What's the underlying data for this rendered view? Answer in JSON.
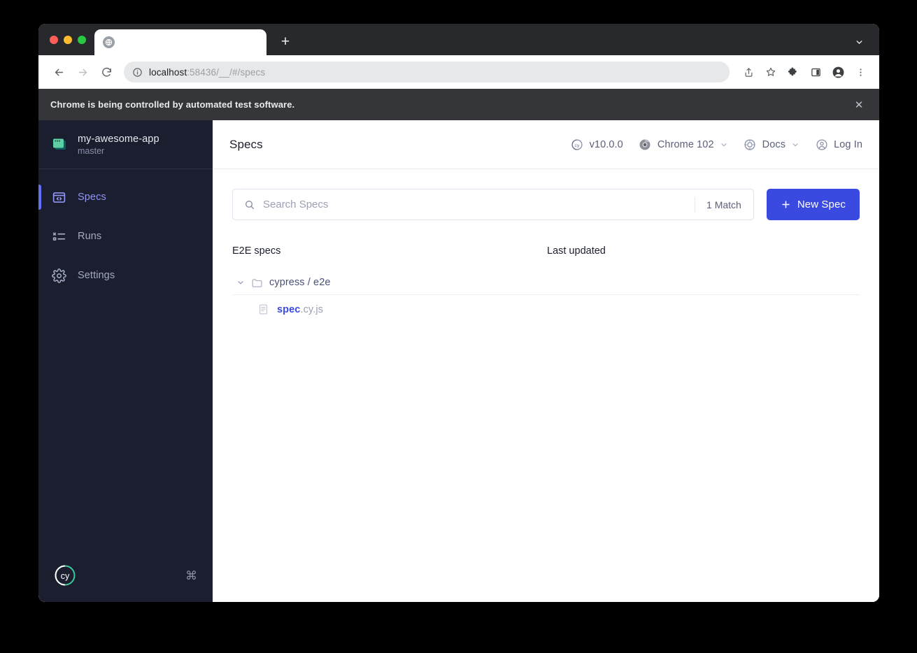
{
  "browser": {
    "traffic_lights": [
      "close",
      "minimize",
      "maximize"
    ],
    "tab": {
      "title": "",
      "favicon": "globe-icon"
    },
    "new_tab_label": "+",
    "tab_search": "chevron-down-icon",
    "toolbar": {
      "back": "back-arrow-icon",
      "forward": "forward-arrow-icon",
      "reload": "reload-icon",
      "site_info": "info-circle-icon",
      "url_host": "localhost",
      "url_path": ":58436/__/#/specs",
      "url_full": "localhost:58436/__/#/specs",
      "icons": [
        "share-icon",
        "bookmark-star-icon",
        "extensions-puzzle-icon",
        "side-panel-icon",
        "profile-avatar-icon",
        "more-menu-icon"
      ]
    },
    "infobar": {
      "message": "Chrome is being controlled by automated test software.",
      "close": "✕"
    }
  },
  "sidebar": {
    "project": {
      "name": "my-awesome-app",
      "branch": "master",
      "icon": "project-window-icon"
    },
    "items": [
      {
        "label": "Specs",
        "icon": "specs-code-window-icon",
        "active": true
      },
      {
        "label": "Runs",
        "icon": "runs-list-icon",
        "active": false
      },
      {
        "label": "Settings",
        "icon": "gear-icon",
        "active": false
      }
    ],
    "footer": {
      "logo": "cypress-cy-logo",
      "shortcut": "⌘"
    }
  },
  "header": {
    "title": "Specs",
    "items": [
      {
        "label": "v10.0.0",
        "icon": "cypress-logo-icon",
        "chevron": false
      },
      {
        "label": "Chrome 102",
        "icon": "chrome-browser-icon",
        "chevron": true
      },
      {
        "label": "Docs",
        "icon": "docs-globe-icon",
        "chevron": true
      },
      {
        "label": "Log In",
        "icon": "user-circle-icon",
        "chevron": false
      }
    ]
  },
  "search": {
    "placeholder": "Search Specs",
    "value": "",
    "match_count": "1 Match",
    "icon": "search-icon"
  },
  "new_spec_button": {
    "label": "New Spec",
    "icon": "plus-icon"
  },
  "spec_list": {
    "columns": {
      "specs": "E2E specs",
      "updated": "Last updated"
    },
    "folders": [
      {
        "name": "cypress / e2e",
        "expanded": true,
        "chevron": "chevron-down-icon",
        "icon": "folder-icon",
        "specs": [
          {
            "base": "spec",
            "ext": ".cy.js",
            "icon": "file-document-icon",
            "last_updated": ""
          }
        ]
      }
    ]
  },
  "colors": {
    "accent_blue": "#3a4ae0",
    "sidebar_bg": "#1b1e2e",
    "active_nav": "#9095f5",
    "project_green": "#5ecfa4",
    "page_bg": "#ffffff"
  }
}
